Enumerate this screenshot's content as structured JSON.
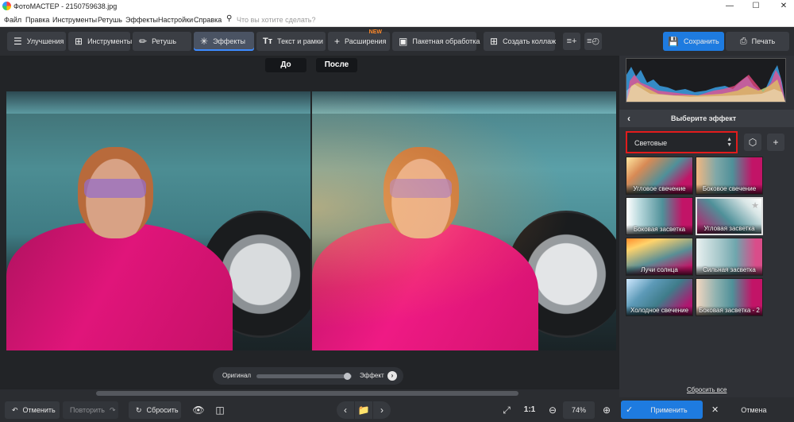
{
  "window": {
    "title": "ФотоМАСТЕР - 2150759638.jpg",
    "min": "—",
    "max": "☐",
    "close": "✕"
  },
  "menu": {
    "items": [
      "Файл",
      "Правка",
      "Инструменты",
      "Ретушь",
      "Эффекты",
      "Настройки",
      "Справка"
    ],
    "search_placeholder": "Что вы хотите сделать?"
  },
  "toolbar": {
    "tabs": [
      {
        "label": "Улучшения",
        "icon": "layers-icon"
      },
      {
        "label": "Инструменты",
        "icon": "crop-icon"
      },
      {
        "label": "Ретушь",
        "icon": "brush-icon"
      },
      {
        "label": "Эффекты",
        "icon": "sparkle-icon"
      },
      {
        "label": "Текст и рамки",
        "icon": "text-icon"
      },
      {
        "label": "Расширения",
        "icon": "plus-icon",
        "badge": "NEW"
      },
      {
        "label": "Пакетная обработка",
        "icon": "images-icon"
      },
      {
        "label": "Создать коллаж",
        "icon": "grid-icon"
      }
    ],
    "save_label": "Сохранить",
    "print_label": "Печать"
  },
  "canvas": {
    "before_label": "До",
    "after_label": "После",
    "compare_original": "Оригинал",
    "compare_effect": "Эффект",
    "compare_slider_value": 0.95
  },
  "panel": {
    "title": "Выберите эффект",
    "category": "Световые",
    "effects": [
      "Угловое свечение",
      "Боковое свечение",
      "Боковая засветка",
      "Угловая засветка",
      "Лучи солнца",
      "Сильная засветка",
      "Холодное свечение",
      "Боковая засветка - 2"
    ],
    "selected_effect": "Угловая засветка",
    "reset_all": "Сбросить все"
  },
  "bottom": {
    "undo": "Отменить",
    "redo": "Повторить",
    "reset": "Сбросить",
    "ratio": "1:1",
    "zoom": "74%",
    "apply": "Применить",
    "cancel": "Отмена"
  },
  "colors": {
    "accent": "#1e7be0",
    "select_border": "#e21c1c",
    "new_badge": "#ff8a2b",
    "active_tab_underline": "#3d8bff"
  }
}
